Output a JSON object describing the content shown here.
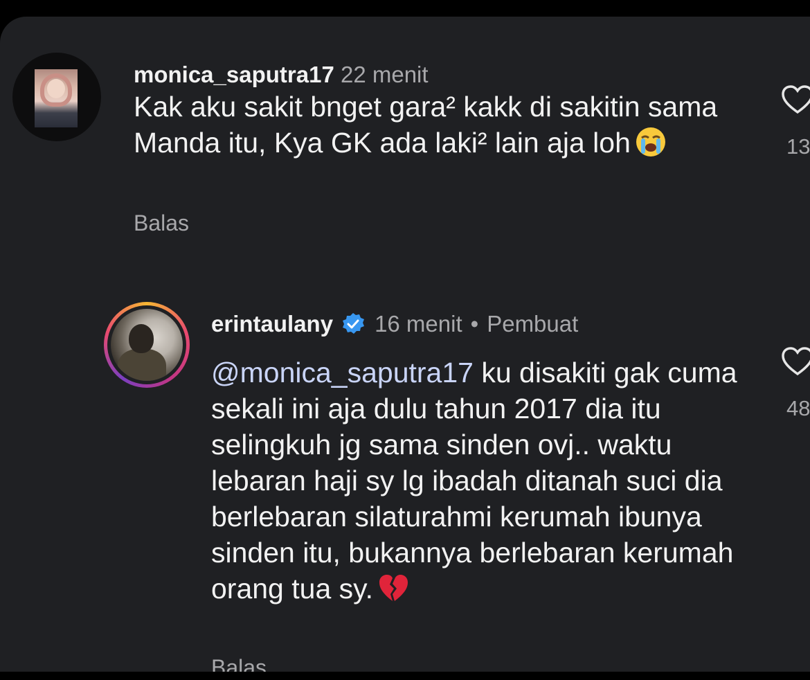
{
  "comments": [
    {
      "username": "monica_saputra17",
      "time": "22 menit",
      "text": "Kak aku sakit bnget gara² kakk di sakitin sama Manda itu, Kya GK ada laki² lain aja loh",
      "emoji": "loudly-crying-face",
      "reply_label": "Balas",
      "like_icon": "heart-outline-icon",
      "like_count": "13"
    },
    {
      "username": "erintaulany",
      "verified": true,
      "time": "16 menit",
      "separator": "•",
      "creator_label": "Pembuat",
      "mention": "@monica_saputra17",
      "text": "ku disakiti gak cuma sekali ini aja dulu tahun 2017 dia itu selingkuh jg sama sinden ovj.. waktu lebaran haji sy lg ibadah ditanah suci dia berlebaran silaturahmi kerumah ibunya sinden itu, bukannya berlebaran kerumah orang tua sy.",
      "emoji": "broken-heart",
      "reply_label": "Balas",
      "like_icon": "heart-outline-icon",
      "like_count": "48"
    }
  ],
  "colors": {
    "background": "#1f2023",
    "text": "#f2f2f2",
    "secondary": "#a8a8ab",
    "mention": "#c9d4f7",
    "verified": "#3897f0"
  }
}
